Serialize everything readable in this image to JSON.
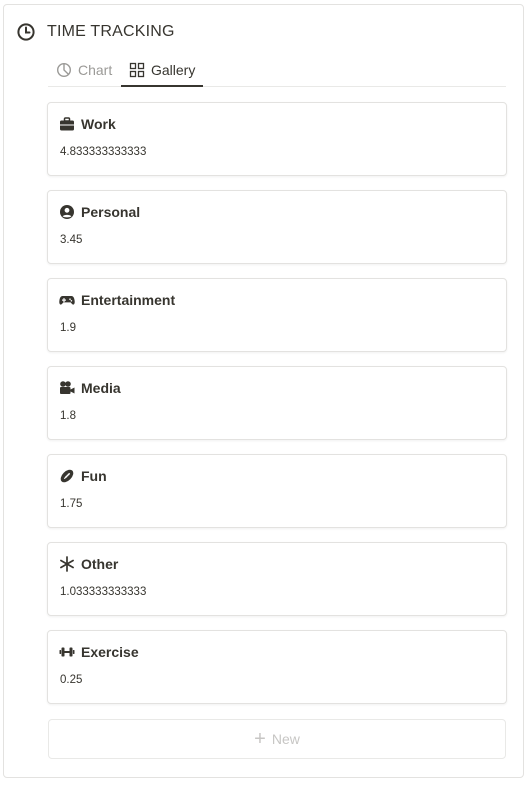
{
  "header": {
    "title": "TIME TRACKING",
    "icon": "clock-icon"
  },
  "tabs": [
    {
      "label": "Chart",
      "icon": "pie-chart-icon",
      "active": false
    },
    {
      "label": "Gallery",
      "icon": "grid-icon",
      "active": true
    }
  ],
  "cards": [
    {
      "name": "Work",
      "value": "4.833333333333",
      "icon": "briefcase-icon"
    },
    {
      "name": "Personal",
      "value": "3.45",
      "icon": "user-circle-icon"
    },
    {
      "name": "Entertainment",
      "value": "1.9",
      "icon": "gamepad-icon"
    },
    {
      "name": "Media",
      "value": "1.8",
      "icon": "video-camera-icon"
    },
    {
      "name": "Fun",
      "value": "1.75",
      "icon": "football-icon"
    },
    {
      "name": "Other",
      "value": "1.033333333333",
      "icon": "asterisk-icon"
    },
    {
      "name": "Exercise",
      "value": "0.25",
      "icon": "dumbbell-icon"
    }
  ],
  "new_button": {
    "label": "New",
    "icon": "plus-icon"
  },
  "colors": {
    "text": "#37352f",
    "muted": "#9b9a97",
    "border": "#e3e2e0"
  }
}
